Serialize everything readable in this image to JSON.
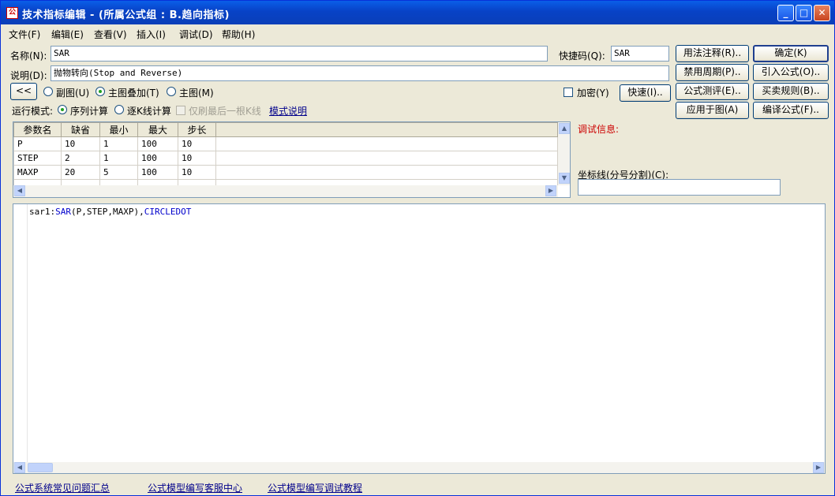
{
  "window": {
    "title": "技术指标编辑 - (所属公式组 : B.趋向指标)",
    "app_icon": "app-icon"
  },
  "menu": [
    "文件(F)",
    "编辑(E)",
    "查看(V)",
    "插入(I)",
    "调试(D)",
    "帮助(H)"
  ],
  "form": {
    "name_label": "名称(N):",
    "name_value": "SAR",
    "hotkey_label": "快捷码(Q):",
    "hotkey_value": "SAR",
    "desc_label": "说明(D):",
    "desc_value": "抛物转向(Stop and Reverse)"
  },
  "buttons": {
    "usage_notes": "用法注释(R)..",
    "ok": "确定(K)",
    "disabled_periods": "禁用周期(P)..",
    "import": "引入公式(O)..",
    "evaluate": "公式测评(E)..",
    "trade_rules": "买卖规则(B)..",
    "apply_to_chart": "应用于图(A)",
    "compile": "编译公式(F)..",
    "quick": "快速(I)..",
    "collapse": "<<"
  },
  "chart_type": {
    "options": [
      "副图(U)",
      "主图叠加(T)",
      "主图(M)"
    ],
    "selected": "主图叠加(T)"
  },
  "encrypt_label": "加密(Y)",
  "run_mode": {
    "label": "运行模式:",
    "options": [
      "序列计算",
      "逐K线计算"
    ],
    "selected": "序列计算",
    "last_bar_only": "仅刷最后一根K线",
    "mode_help": "模式说明"
  },
  "params_table": {
    "headers": [
      "参数名",
      "缺省",
      "最小",
      "最大",
      "步长"
    ],
    "rows": [
      [
        "P",
        "10",
        "1",
        "100",
        "10"
      ],
      [
        "STEP",
        "2",
        "1",
        "100",
        "10"
      ],
      [
        "MAXP",
        "20",
        "5",
        "100",
        "10"
      ]
    ]
  },
  "debug_info_label": "调试信息:",
  "axis_lines_label": "坐标线(分号分割)(C):",
  "axis_lines_value": "",
  "code": {
    "name": "sar1",
    "call": "SAR",
    "args": "(P,STEP,MAXP),",
    "style": "CIRCLEDOT"
  },
  "footer_links": [
    "公式系统常见问题汇总",
    "公式模型编写客服中心",
    "公式模型编写调试教程"
  ],
  "colors": {
    "title_bar": "#0842c6",
    "debug_label": "#cc0000",
    "link": "#00008b",
    "keyword": "#0000cc"
  }
}
